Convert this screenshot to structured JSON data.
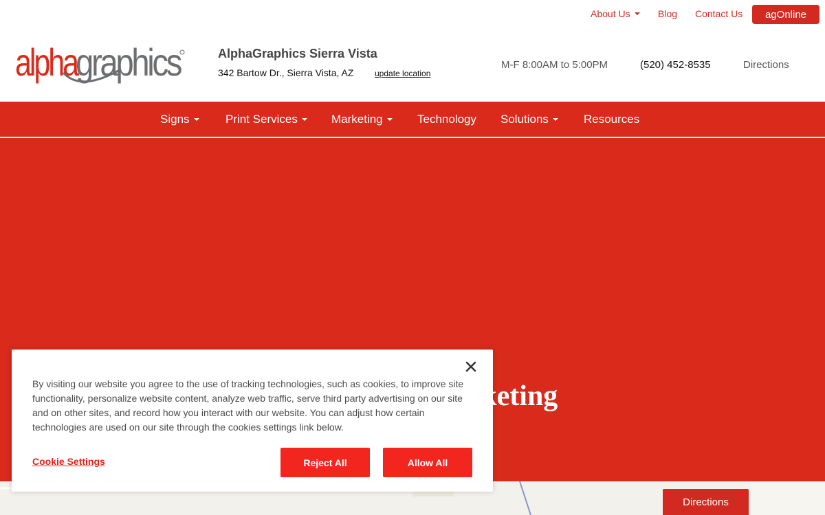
{
  "brand": {
    "logo_alpha": "alpha",
    "logo_graphics": "graphics",
    "color_red": "#d92a1c",
    "color_gray": "#6d6e71"
  },
  "util_nav": {
    "about": "About Us",
    "blog": "Blog",
    "contact": "Contact Us",
    "ag_online": "agOnline"
  },
  "store": {
    "name": "AlphaGraphics Sierra Vista",
    "address": "342 Bartow Dr., Sierra Vista, AZ",
    "update_location": "update location",
    "hours": "M-F 8:00AM to 5:00PM",
    "phone": "(520) 452-8535",
    "directions": "Directions"
  },
  "main_nav": {
    "items": [
      {
        "label": "Signs",
        "dropdown": true
      },
      {
        "label": "Print Services",
        "dropdown": true
      },
      {
        "label": "Marketing",
        "dropdown": true
      },
      {
        "label": "Technology",
        "dropdown": false
      },
      {
        "label": "Solutions",
        "dropdown": true
      },
      {
        "label": "Resources",
        "dropdown": false
      }
    ]
  },
  "hero": {
    "title_visible": "Marketing"
  },
  "map": {
    "directions_button": "Directions"
  },
  "cookie": {
    "text": "By visiting our website you agree to the use of tracking technologies, such as cookies, to improve site functionality, personalize website content, analyze web traffic, serve third party advertising on our site and on other sites, and record how you interact with our website. You can adjust how certain technologies are used on our site through the cookies settings link below.",
    "settings_link": "Cookie Settings",
    "reject": "Reject All",
    "allow": "Allow All"
  }
}
